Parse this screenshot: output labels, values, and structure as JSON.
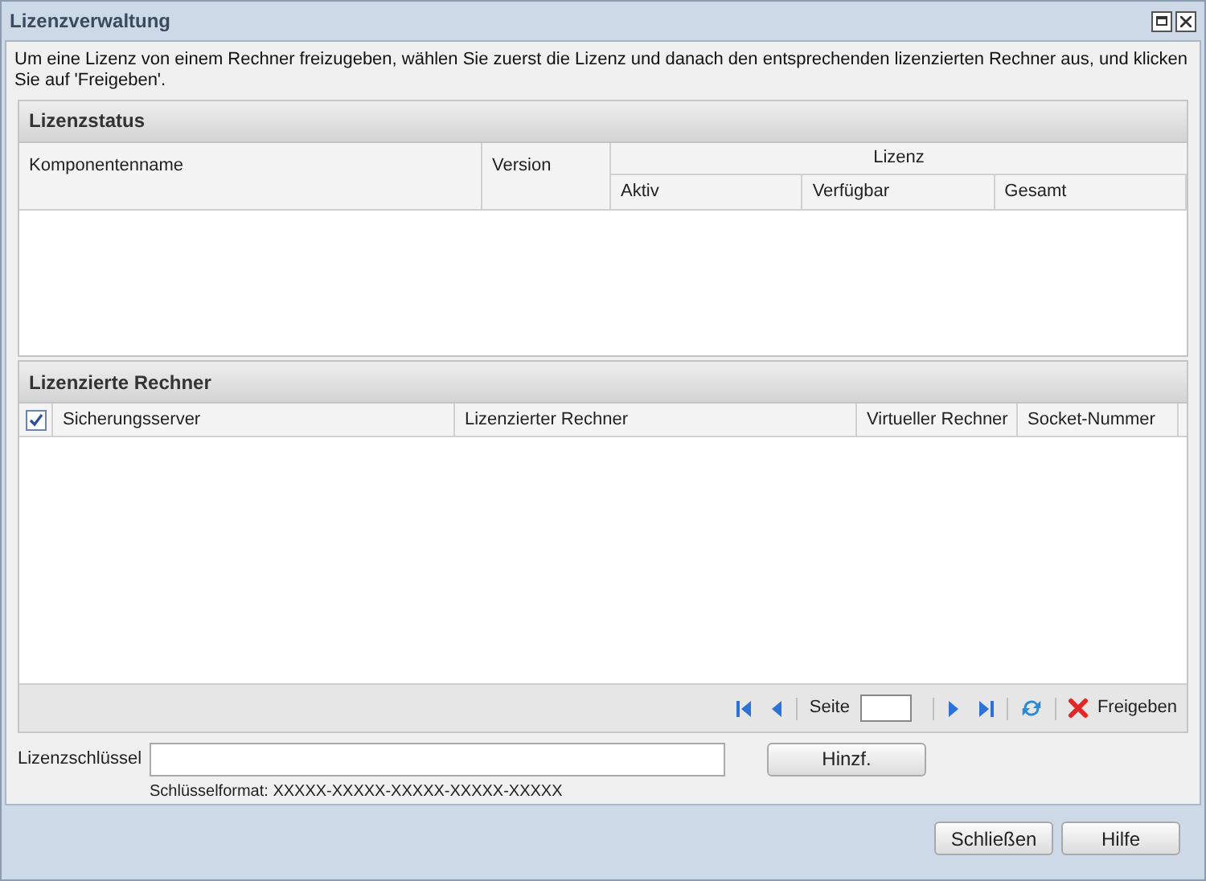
{
  "window": {
    "title": "Lizenzverwaltung"
  },
  "instructions": "Um eine Lizenz von einem Rechner freizugeben, wählen Sie zuerst die Lizenz und danach den entsprechenden lizenzierten Rechner aus, und klicken Sie auf 'Freigeben'.",
  "license_status": {
    "title": "Lizenzstatus",
    "columns": [
      "Komponentenname",
      "Version"
    ],
    "group": {
      "label": "Lizenz",
      "columns": [
        "Aktiv",
        "Verfügbar",
        "Gesamt"
      ]
    }
  },
  "licensed_computers": {
    "title": "Lizenzierte Rechner",
    "select_all_checked": true,
    "columns": [
      "Sicherungsserver",
      "Lizenzierter Rechner",
      "Virtueller Rechner",
      "Socket-Nummer"
    ],
    "pager": {
      "page_label": "Seite",
      "release_button": "Freigeben"
    }
  },
  "license_key": {
    "label": "Lizenzschlüssel",
    "add_button": "Hinzf.",
    "format_hint": "Schlüsselformat: XXXXX-XXXXX-XXXXX-XXXXX-XXXXX"
  },
  "buttons": [
    "Schließen",
    "Hilfe"
  ]
}
